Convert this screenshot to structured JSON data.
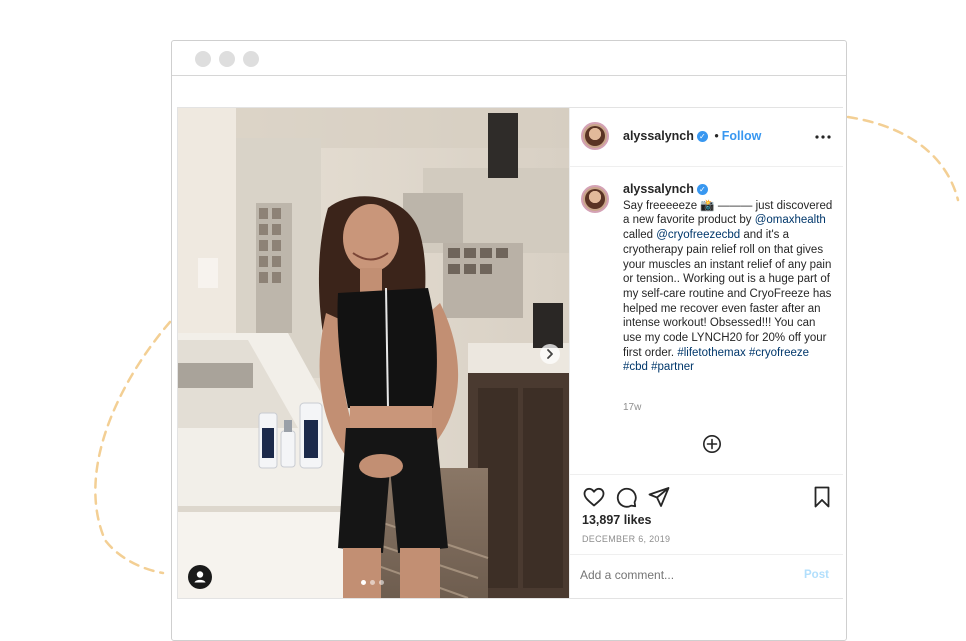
{
  "window": {
    "controls": [
      "close",
      "minimize",
      "maximize"
    ]
  },
  "post": {
    "header": {
      "username": "alyssalynch",
      "separator": "•",
      "follow_label": "Follow",
      "more_icon": "more-dots-icon",
      "verified_icon": "verified-badge-icon"
    },
    "caption": {
      "username": "alyssalynch",
      "part1": "Say freeeeeze 📸 ——— just discovered a new favorite product by ",
      "mention1": "@omaxhealth",
      "part2": " called ",
      "mention2": "@cryofreezecbd",
      "part3": " and it's a cryotherapy pain relief roll on that gives your muscles an instant relief of any pain or tension.. Working out is a huge part of my self-care routine and CryoFreeze has helped me recover even faster after an intense workout! Obsessed!!! You can use my code LYNCH20 for 20% off your first order. ",
      "hashtag1": "#lifetothemax",
      "hashtag2": "#cryofreeze",
      "hashtag3": "#cbd",
      "hashtag4": "#partner",
      "age": "17w"
    },
    "likes": "13,897 likes",
    "date": "DECEMBER 6, 2019",
    "comment_placeholder": "Add a comment...",
    "post_label": "Post",
    "carousel": {
      "slides": 3,
      "current": 1
    },
    "icons": [
      "heart-icon",
      "comment-icon",
      "share-icon",
      "bookmark-icon",
      "add-circle-icon",
      "next-arrow-icon",
      "user-tag-icon"
    ]
  },
  "colors": {
    "accent": "#3897f0",
    "link": "#00376b",
    "muted": "#8e8e8e",
    "decor_dash": "#f2c98a"
  }
}
